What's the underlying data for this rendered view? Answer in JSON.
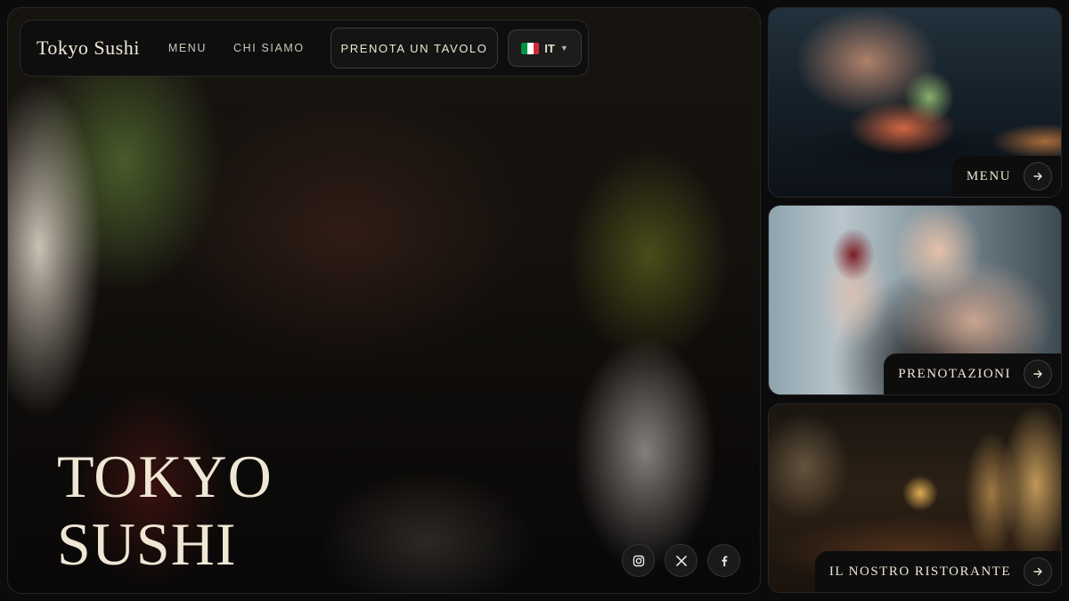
{
  "brand": "Tokyo Sushi",
  "nav": {
    "links": [
      "MENU",
      "CHI SIAMO"
    ],
    "reserve_label": "PRENOTA UN TAVOLO",
    "language": "IT"
  },
  "hero": {
    "title_line1": "TOKYO",
    "title_line2": "SUSHI"
  },
  "socials": [
    "instagram-icon",
    "x-icon",
    "facebook-icon"
  ],
  "cards": [
    {
      "label": "MENU"
    },
    {
      "label": "PRENOTAZIONI"
    },
    {
      "label": "IL NOSTRO RISTORANTE"
    }
  ],
  "colors": {
    "background": "#0b0b0b",
    "text_cream": "#efe6d4",
    "panel": "#0e0e0e",
    "flag_green": "#009246",
    "flag_white": "#ffffff",
    "flag_red": "#ce2b37"
  }
}
